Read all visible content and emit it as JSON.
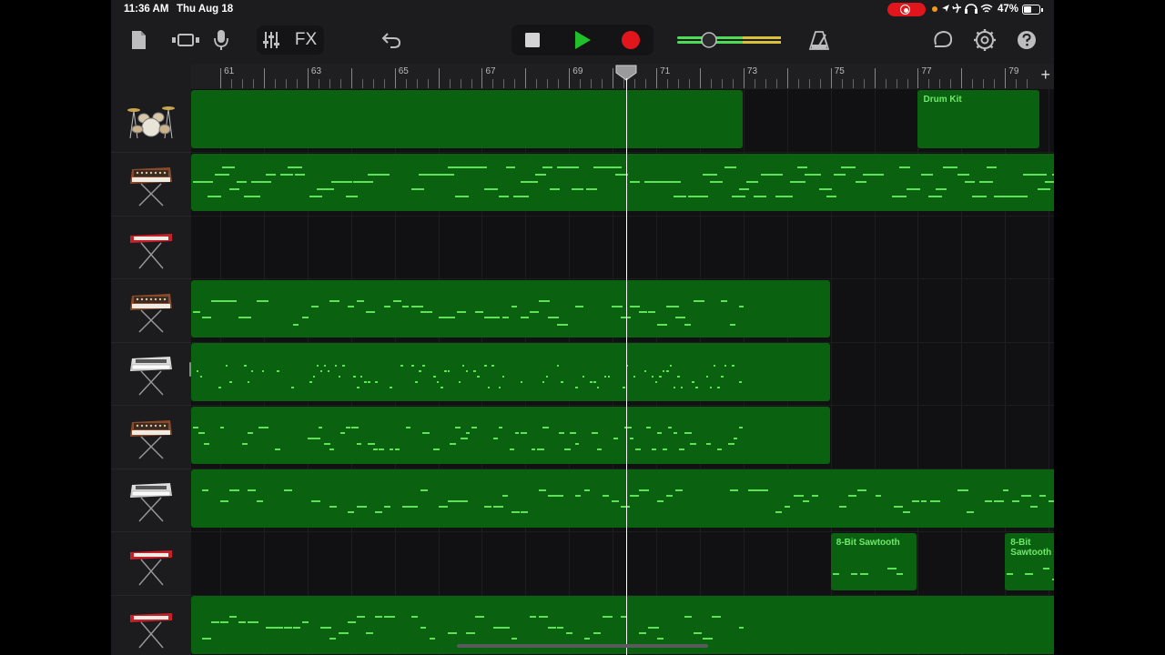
{
  "status_bar": {
    "time": "11:36 AM",
    "date": "Thu Aug 18",
    "battery_text": "47%",
    "battery_level": 0.47,
    "icons": [
      "screen-record-icon",
      "location-icon",
      "airplane-icon",
      "headphones-icon",
      "wifi-icon",
      "battery-icon"
    ]
  },
  "toolbar": {
    "fx_label": "FX",
    "master_volume": 0.3,
    "colors": {
      "play": "#20c02a",
      "record": "#e0161c",
      "meter_green": "#4ddc57",
      "meter_yellow": "#d8c23a"
    }
  },
  "ruler": {
    "bars": [
      "61",
      "63",
      "65",
      "67",
      "69",
      "71",
      "73",
      "75",
      "77",
      "79"
    ],
    "add_label": "+"
  },
  "timeline": {
    "first_bar": 60.33,
    "bar_count": 19.8,
    "playhead_bar": 70.3
  },
  "tracks": [
    {
      "instrument": "drum-kit",
      "regions": [
        {
          "start": 60.33,
          "end": 73.0,
          "name": "",
          "pattern": "none"
        },
        {
          "start": 77.0,
          "end": 79.8,
          "name": "Drum Kit",
          "pattern": "none"
        }
      ]
    },
    {
      "instrument": "synth-keyboard",
      "regions": [
        {
          "start": 60.33,
          "end": 80.2,
          "name": "",
          "pattern": "dense"
        }
      ]
    },
    {
      "instrument": "red-keyboard",
      "regions": []
    },
    {
      "instrument": "synth-keyboard",
      "regions": [
        {
          "start": 60.33,
          "end": 75.0,
          "name": "",
          "pattern": "melody",
          "notes_end": 73.0
        }
      ]
    },
    {
      "instrument": "white-keyboard",
      "regions": [
        {
          "start": 60.33,
          "end": 75.0,
          "name": "",
          "pattern": "dots",
          "notes_end": 73.0
        }
      ]
    },
    {
      "instrument": "synth-keyboard",
      "regions": [
        {
          "start": 60.33,
          "end": 75.0,
          "name": "",
          "pattern": "zigzag",
          "notes_end": 73.0
        }
      ]
    },
    {
      "instrument": "white-keyboard",
      "regions": [
        {
          "start": 60.33,
          "end": 80.2,
          "name": "",
          "pattern": "wave"
        }
      ]
    },
    {
      "instrument": "red-keyboard",
      "regions": [
        {
          "start": 75.0,
          "end": 77.0,
          "name": "8-Bit Sawtooth",
          "pattern": "sparse"
        },
        {
          "start": 79.0,
          "end": 80.2,
          "name": "8-Bit Sawtooth",
          "pattern": "sparse"
        }
      ]
    },
    {
      "instrument": "red-keyboard",
      "regions": [
        {
          "start": 60.33,
          "end": 80.2,
          "name": "",
          "pattern": "wave",
          "notes_end": 73.0
        }
      ]
    }
  ]
}
